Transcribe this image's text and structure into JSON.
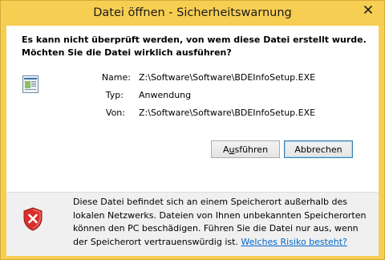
{
  "window": {
    "title": "Datei öffnen - Sicherheitswarnung"
  },
  "heading": {
    "line1": "Es kann nicht überprüft werden, von wem diese Datei erstellt wurde.",
    "line2": "Möchten Sie die Datei wirklich ausführen?"
  },
  "details": {
    "name_label": "Name:",
    "name_value": "Z:\\Software\\Software\\BDEInfoSetup.EXE",
    "type_label": "Typ:",
    "type_value": "Anwendung",
    "from_label": "Von:",
    "from_value": "Z:\\Software\\Software\\BDEInfoSetup.EXE"
  },
  "buttons": {
    "run_prefix": "A",
    "run_accel": "u",
    "run_suffix": "sführen",
    "cancel": "Abbrechen"
  },
  "warning": {
    "text": "Diese Datei befindet sich an einem Speicherort außerhalb des lokalen Netzwerks. Dateien von Ihnen unbekannten Speicherorten können den PC beschädigen. Führen Sie die Datei nur aus, wenn der Speicherort vertrauenswürdig ist. ",
    "link": "Welches Risiko besteht?"
  },
  "icons": {
    "close": "close-icon",
    "file": "application-file-icon",
    "shield": "security-warning-shield-icon"
  },
  "colors": {
    "frame": "#f6ce52",
    "link": "#0066cc",
    "shield": "#d9302c"
  }
}
